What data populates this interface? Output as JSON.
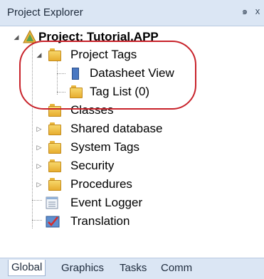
{
  "panel": {
    "title": "Project Explorer",
    "pin_glyph": "๑",
    "close_glyph": "x"
  },
  "tree": {
    "root": "Project: Tutorial.APP",
    "project_tags": "Project Tags",
    "datasheet_view": "Datasheet View",
    "tag_list": "Tag List (0)",
    "classes": "Classes",
    "shared_database": "Shared database",
    "system_tags": "System Tags",
    "security": "Security",
    "procedures": "Procedures",
    "event_logger": "Event Logger",
    "translation": "Translation"
  },
  "tabs": [
    "Global",
    "Graphics",
    "Tasks",
    "Comm"
  ],
  "colors": {
    "highlight": "#c8222a",
    "chrome": "#dbe6f4"
  }
}
